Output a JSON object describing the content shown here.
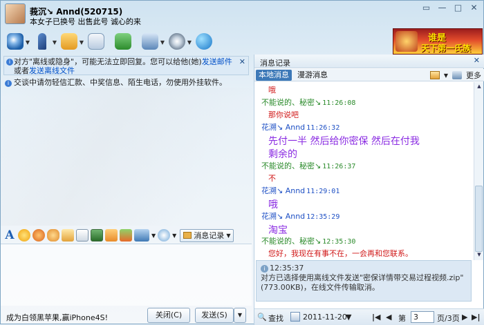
{
  "header": {
    "nickname": "莪沉↘ Annd(520715)",
    "signature": "本女子已换号 出售此号  诚心的来",
    "window_buttons": [
      "▭",
      "—",
      "□",
      "✕"
    ]
  },
  "toolbar": {
    "icons": [
      "video-call",
      "voice-call",
      "send-file",
      "email",
      "app-box",
      "remote-assist",
      "settings",
      "qq-browser"
    ]
  },
  "ad": {
    "line1": "谁是",
    "line2": "天下第一氏族"
  },
  "notice": {
    "text1": "对方\"离线或隐身\"，可能无法立即回复。您可以给他(她)",
    "link1": "发送邮件",
    "text2": "或者",
    "link2": "发送离线文件"
  },
  "warning": "交谈中请勿轻信汇款、中奖信息、陌生电话，勿使用外挂软件。",
  "format_bar": {
    "font_label": "A",
    "history_button": "消息记录"
  },
  "bottom": {
    "promo": "成为白领黑苹果,赢iPhone4S!",
    "close_button": "关闭(C)",
    "send_button": "发送(S)"
  },
  "history": {
    "title": "消息记录",
    "tabs": [
      "本地消息",
      "漫游消息"
    ],
    "more_label": "更多",
    "messages": [
      {
        "kind": "text",
        "color": "red",
        "text": "哦"
      },
      {
        "kind": "meta",
        "color": "green",
        "sender": "不能说的、秘密↘",
        "time": "11:26:08"
      },
      {
        "kind": "text",
        "color": "red",
        "text": "那你说吧"
      },
      {
        "kind": "meta",
        "color": "blue",
        "sender": "花溯↘ Annd",
        "time": "11:26:32"
      },
      {
        "kind": "text",
        "color": "purple",
        "text": "先付一半  然后给你密保  然后在付我"
      },
      {
        "kind": "text",
        "color": "purple",
        "text": "剩余的"
      },
      {
        "kind": "meta",
        "color": "green",
        "sender": "不能说的、秘密↘",
        "time": "11:26:37"
      },
      {
        "kind": "text",
        "color": "red",
        "text": "不"
      },
      {
        "kind": "meta",
        "color": "blue",
        "sender": "花溯↘ Annd",
        "time": "11:29:01"
      },
      {
        "kind": "text",
        "color": "purple",
        "text": "哦"
      },
      {
        "kind": "meta",
        "color": "blue",
        "sender": "花溯↘ Annd",
        "time": "12:35:29"
      },
      {
        "kind": "text",
        "color": "purple",
        "text": "淘宝"
      },
      {
        "kind": "meta",
        "color": "green",
        "sender": "不能说的、秘密↘",
        "time": "12:35:30"
      },
      {
        "kind": "text",
        "color": "red",
        "text": "您好，我现在有事不在，一会再和您联系。"
      }
    ],
    "system_message": {
      "time": "12:35:37",
      "line1": "对方已选择使用离线文件发送\"密保详情带交易过程视频.zip\"",
      "line2": "(773.00KB)，在线文件传输取消。"
    },
    "footer": {
      "find_label": "查找",
      "date": "2011-11-20",
      "page_prefix": "第",
      "page_value": "3",
      "page_suffix": "页/3页"
    }
  },
  "colors": {
    "accent": "#3d79b8",
    "link": "#0050c8",
    "green": "#2a8a2a",
    "blue": "#1d4fc4",
    "red": "#d01818",
    "purple": "#8a2be2"
  }
}
